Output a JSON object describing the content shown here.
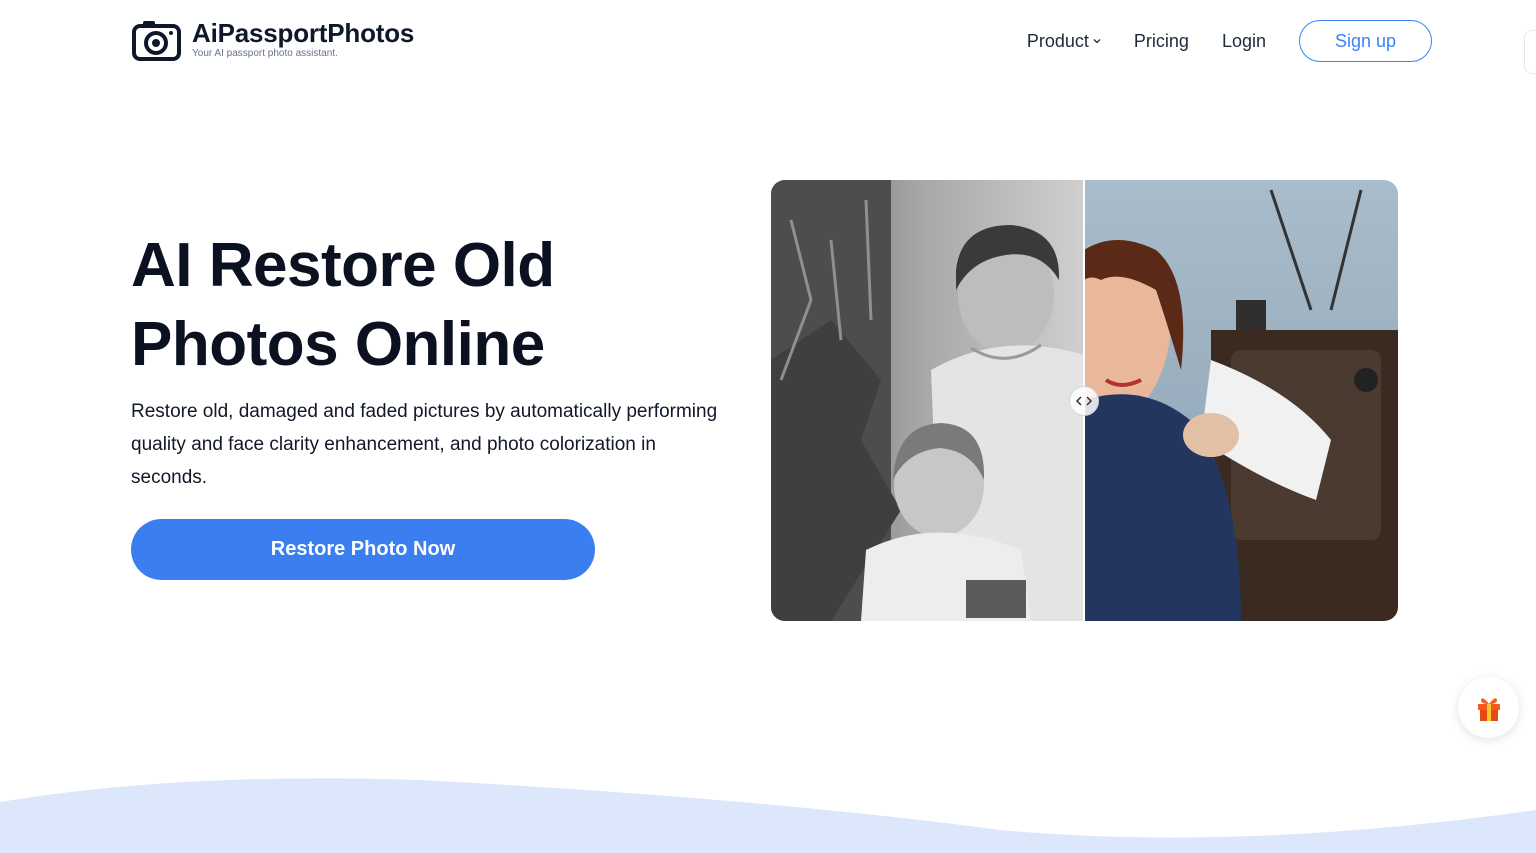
{
  "brand": {
    "name": "AiPassportPhotos",
    "tagline": "Your AI passport photo assistant."
  },
  "nav": {
    "product": "Product",
    "pricing": "Pricing",
    "login": "Login",
    "signup": "Sign up"
  },
  "hero": {
    "title_line1": "AI Restore Old",
    "title_line2": "Photos Online",
    "description": "Restore old, damaged and faded pictures by automatically performing quality and face clarity enhancement, and photo colorization in seconds.",
    "cta": "Restore Photo Now"
  },
  "compare": {
    "slider_position": 0.5
  },
  "colors": {
    "accent": "#3b7ef0",
    "text": "#0b1120",
    "wave": "#dce7fb"
  },
  "icons": {
    "logo": "camera-icon",
    "product_menu": "chevron-down-icon",
    "slider": "chevrons-left-right-icon",
    "gift": "gift-icon"
  }
}
